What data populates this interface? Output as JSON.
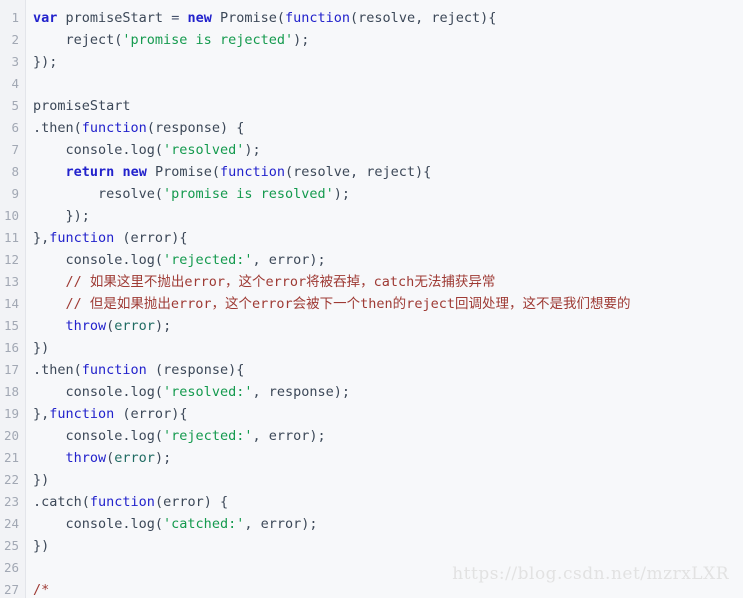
{
  "editor": {
    "language": "javascript",
    "background_color": "#f7f8fa",
    "gutter_color": "#f2f3f6",
    "line_number_color": "#a2a8b4",
    "first_visible_line": 1,
    "last_visible_line": 27,
    "total_visible_lines": 27
  },
  "colors": {
    "keyword": "#2222cc",
    "string": "#149a4e",
    "comment": "#9e3a34",
    "identifier": "#3c4858",
    "punctuation": "#44506a",
    "watermark": "#e2e2e2"
  },
  "watermark": {
    "text": "https://blog.csdn.net/mzrxLXR"
  },
  "lines": [
    {
      "n": "1",
      "tokens": [
        {
          "t": "kwb",
          "v": "var"
        },
        {
          "t": "plain",
          "v": " promiseStart "
        },
        {
          "t": "punc",
          "v": "="
        },
        {
          "t": "plain",
          "v": " "
        },
        {
          "t": "kwb",
          "v": "new"
        },
        {
          "t": "plain",
          "v": " Promise("
        },
        {
          "t": "kw",
          "v": "function"
        },
        {
          "t": "plain",
          "v": "(resolve, reject){"
        }
      ]
    },
    {
      "n": "2",
      "tokens": [
        {
          "t": "plain",
          "v": "    reject("
        },
        {
          "t": "str",
          "v": "'promise is rejected'"
        },
        {
          "t": "plain",
          "v": ");"
        }
      ]
    },
    {
      "n": "3",
      "tokens": [
        {
          "t": "plain",
          "v": "});"
        }
      ]
    },
    {
      "n": "4",
      "tokens": [
        {
          "t": "plain",
          "v": ""
        }
      ]
    },
    {
      "n": "5",
      "tokens": [
        {
          "t": "plain",
          "v": "promiseStart"
        }
      ]
    },
    {
      "n": "6",
      "tokens": [
        {
          "t": "plain",
          "v": ".then("
        },
        {
          "t": "kw",
          "v": "function"
        },
        {
          "t": "plain",
          "v": "(response) {"
        }
      ]
    },
    {
      "n": "7",
      "tokens": [
        {
          "t": "plain",
          "v": "    console.log("
        },
        {
          "t": "str",
          "v": "'resolved'"
        },
        {
          "t": "plain",
          "v": ");"
        }
      ]
    },
    {
      "n": "8",
      "tokens": [
        {
          "t": "plain",
          "v": "    "
        },
        {
          "t": "kwb",
          "v": "return"
        },
        {
          "t": "plain",
          "v": " "
        },
        {
          "t": "kwb",
          "v": "new"
        },
        {
          "t": "plain",
          "v": " Promise("
        },
        {
          "t": "kw",
          "v": "function"
        },
        {
          "t": "plain",
          "v": "(resolve, reject){"
        }
      ]
    },
    {
      "n": "9",
      "tokens": [
        {
          "t": "plain",
          "v": "        resolve("
        },
        {
          "t": "str",
          "v": "'promise is resolved'"
        },
        {
          "t": "plain",
          "v": ");"
        }
      ]
    },
    {
      "n": "10",
      "tokens": [
        {
          "t": "plain",
          "v": "    });"
        }
      ]
    },
    {
      "n": "11",
      "tokens": [
        {
          "t": "plain",
          "v": "},"
        },
        {
          "t": "kw",
          "v": "function"
        },
        {
          "t": "plain",
          "v": " (error){"
        }
      ]
    },
    {
      "n": "12",
      "tokens": [
        {
          "t": "plain",
          "v": "    console.log("
        },
        {
          "t": "str",
          "v": "'rejected:'"
        },
        {
          "t": "plain",
          "v": ", error);"
        }
      ]
    },
    {
      "n": "13",
      "tokens": [
        {
          "t": "plain",
          "v": "    "
        },
        {
          "t": "com",
          "v": "// 如果这里不抛出error，这个error将被吞掉，catch无法捕获异常"
        }
      ]
    },
    {
      "n": "14",
      "tokens": [
        {
          "t": "plain",
          "v": "    "
        },
        {
          "t": "com",
          "v": "// 但是如果抛出error，这个error会被下一个then的reject回调处理，这不是我们想要的"
        }
      ]
    },
    {
      "n": "15",
      "tokens": [
        {
          "t": "plain",
          "v": "    "
        },
        {
          "t": "kw",
          "v": "throw"
        },
        {
          "t": "plain",
          "v": "("
        },
        {
          "t": "var",
          "v": "error"
        },
        {
          "t": "plain",
          "v": ");"
        }
      ]
    },
    {
      "n": "16",
      "tokens": [
        {
          "t": "plain",
          "v": "})"
        }
      ]
    },
    {
      "n": "17",
      "tokens": [
        {
          "t": "plain",
          "v": ".then("
        },
        {
          "t": "kw",
          "v": "function"
        },
        {
          "t": "plain",
          "v": " (response){"
        }
      ]
    },
    {
      "n": "18",
      "tokens": [
        {
          "t": "plain",
          "v": "    console.log("
        },
        {
          "t": "str",
          "v": "'resolved:'"
        },
        {
          "t": "plain",
          "v": ", response);"
        }
      ]
    },
    {
      "n": "19",
      "tokens": [
        {
          "t": "plain",
          "v": "},"
        },
        {
          "t": "kw",
          "v": "function"
        },
        {
          "t": "plain",
          "v": " (error){"
        }
      ]
    },
    {
      "n": "20",
      "tokens": [
        {
          "t": "plain",
          "v": "    console.log("
        },
        {
          "t": "str",
          "v": "'rejected:'"
        },
        {
          "t": "plain",
          "v": ", error);"
        }
      ]
    },
    {
      "n": "21",
      "tokens": [
        {
          "t": "plain",
          "v": "    "
        },
        {
          "t": "kw",
          "v": "throw"
        },
        {
          "t": "plain",
          "v": "("
        },
        {
          "t": "var",
          "v": "error"
        },
        {
          "t": "plain",
          "v": ");"
        }
      ]
    },
    {
      "n": "22",
      "tokens": [
        {
          "t": "plain",
          "v": "})"
        }
      ]
    },
    {
      "n": "23",
      "tokens": [
        {
          "t": "plain",
          "v": ".catch("
        },
        {
          "t": "kw",
          "v": "function"
        },
        {
          "t": "plain",
          "v": "(error) {"
        }
      ]
    },
    {
      "n": "24",
      "tokens": [
        {
          "t": "plain",
          "v": "    console.log("
        },
        {
          "t": "str",
          "v": "'catched:'"
        },
        {
          "t": "plain",
          "v": ", error);"
        }
      ]
    },
    {
      "n": "25",
      "tokens": [
        {
          "t": "plain",
          "v": "})"
        }
      ]
    },
    {
      "n": "26",
      "tokens": [
        {
          "t": "plain",
          "v": ""
        }
      ]
    },
    {
      "n": "27",
      "tokens": [
        {
          "t": "com",
          "v": "/*"
        }
      ]
    }
  ]
}
